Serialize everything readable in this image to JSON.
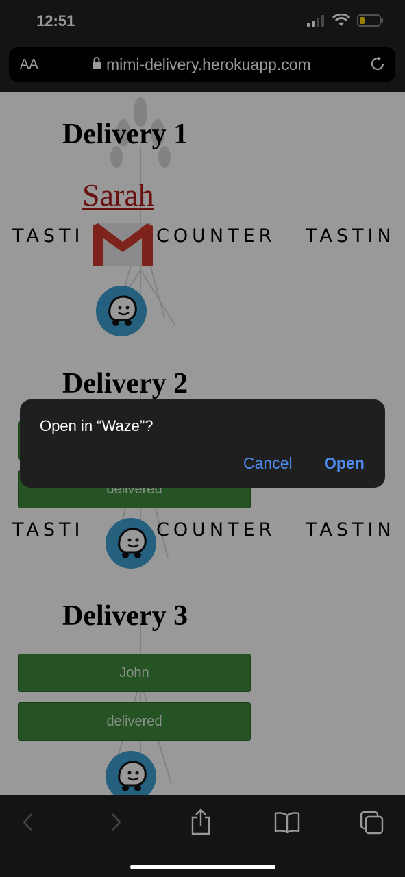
{
  "status": {
    "time": "12:51"
  },
  "browser": {
    "aa_label": "AA",
    "url": "mimi-delivery.herokuapp.com"
  },
  "brand": {
    "strip_text_left": "TASTI",
    "strip_text_mid": "COUNTER",
    "strip_text_right": "TASTIN"
  },
  "deliveries": [
    {
      "title": "Delivery 1",
      "name": "Sarah"
    },
    {
      "title": "Delivery 2",
      "status": "delivered"
    },
    {
      "title": "Delivery 3",
      "name": "John",
      "status": "delivered"
    }
  ],
  "dialog": {
    "title": "Open in “Waze”?",
    "cancel": "Cancel",
    "open": "Open"
  },
  "colors": {
    "green_button": "#3f8a3b",
    "link_red": "#b01b1b",
    "dialog_blue": "#4f8cf0"
  }
}
